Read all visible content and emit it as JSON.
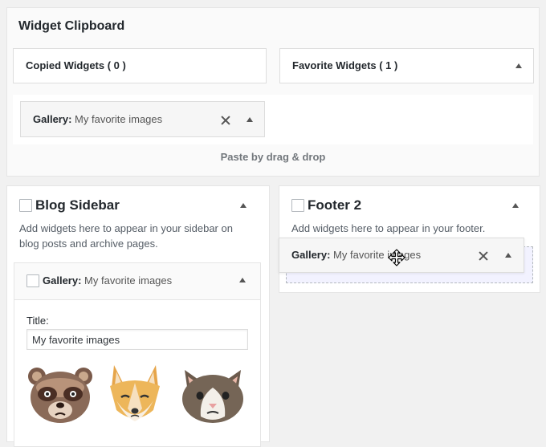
{
  "clipboard": {
    "title": "Widget Clipboard",
    "tabs": [
      {
        "label": "Copied Widgets ( 0 )"
      },
      {
        "label": "Favorite Widgets ( 1 )"
      }
    ],
    "favorite_item": {
      "type": "Gallery:",
      "title": "My favorite images"
    },
    "paste_hint": "Paste by drag & drop"
  },
  "blog_sidebar": {
    "title": "Blog Sidebar",
    "description": "Add widgets here to appear in your sidebar on blog posts and archive pages.",
    "widget": {
      "type": "Gallery:",
      "title": "My favorite images",
      "field_label": "Title:",
      "field_value": "My favorite images",
      "images": [
        "raccoon-image",
        "fox-image",
        "cat-image"
      ]
    }
  },
  "footer2": {
    "title": "Footer 2",
    "description": "Add widgets here to appear in your footer.",
    "dragging_widget": {
      "type": "Gallery:",
      "title": "My favorite images"
    }
  },
  "colors": {
    "accent": "#0073aa",
    "drop_zone": "#f2f2ff",
    "panel": "#fafafa"
  }
}
